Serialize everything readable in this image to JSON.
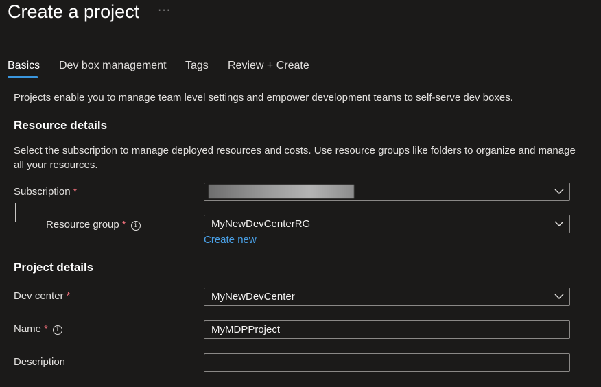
{
  "page": {
    "title": "Create a project",
    "more_label": "···"
  },
  "tabs": [
    {
      "label": "Basics",
      "active": true
    },
    {
      "label": "Dev box management",
      "active": false
    },
    {
      "label": "Tags",
      "active": false
    },
    {
      "label": "Review + Create",
      "active": false
    }
  ],
  "intro": "Projects enable you to manage team level settings and empower development teams to self-serve dev boxes.",
  "resource_details": {
    "heading": "Resource details",
    "description": "Select the subscription to manage deployed resources and costs. Use resource groups like folders to organize and manage all your resources.",
    "subscription": {
      "label": "Subscription",
      "required": "*",
      "value": ""
    },
    "resource_group": {
      "label": "Resource group",
      "required": "*",
      "info": "i",
      "value": "MyNewDevCenterRG",
      "create_new": "Create new"
    }
  },
  "project_details": {
    "heading": "Project details",
    "dev_center": {
      "label": "Dev center",
      "required": "*",
      "value": "MyNewDevCenter"
    },
    "name": {
      "label": "Name",
      "required": "*",
      "info": "i",
      "value": "MyMDPProject"
    },
    "description": {
      "label": "Description",
      "value": ""
    }
  },
  "icons": {
    "dropdown": "chevron-down-icon",
    "info": "info-icon",
    "more": "more-icon"
  },
  "colors": {
    "background": "#1b1a19",
    "accent": "#3a96dd",
    "link": "#4aa0e6",
    "required": "#f1707b",
    "border": "#8a8886"
  }
}
